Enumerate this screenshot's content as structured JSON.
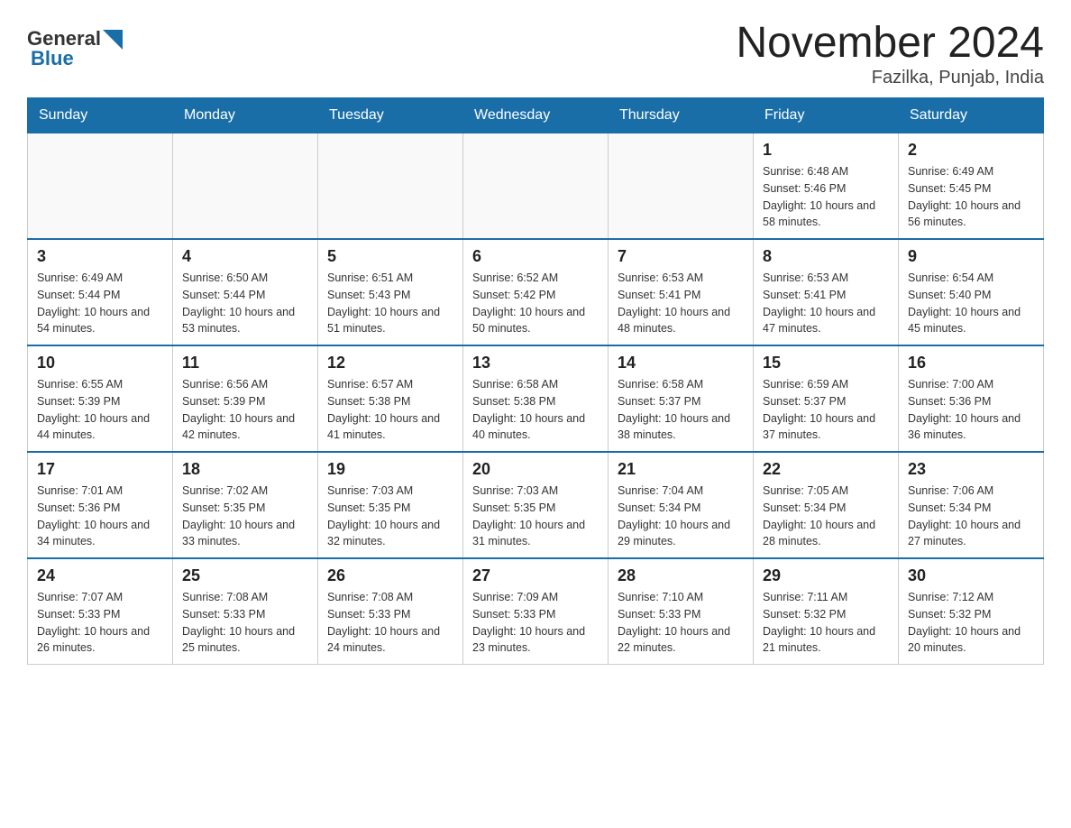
{
  "header": {
    "title": "November 2024",
    "location": "Fazilka, Punjab, India",
    "logo_general": "General",
    "logo_blue": "Blue"
  },
  "weekdays": [
    "Sunday",
    "Monday",
    "Tuesday",
    "Wednesday",
    "Thursday",
    "Friday",
    "Saturday"
  ],
  "weeks": [
    [
      {
        "day": "",
        "info": ""
      },
      {
        "day": "",
        "info": ""
      },
      {
        "day": "",
        "info": ""
      },
      {
        "day": "",
        "info": ""
      },
      {
        "day": "",
        "info": ""
      },
      {
        "day": "1",
        "info": "Sunrise: 6:48 AM\nSunset: 5:46 PM\nDaylight: 10 hours and 58 minutes."
      },
      {
        "day": "2",
        "info": "Sunrise: 6:49 AM\nSunset: 5:45 PM\nDaylight: 10 hours and 56 minutes."
      }
    ],
    [
      {
        "day": "3",
        "info": "Sunrise: 6:49 AM\nSunset: 5:44 PM\nDaylight: 10 hours and 54 minutes."
      },
      {
        "day": "4",
        "info": "Sunrise: 6:50 AM\nSunset: 5:44 PM\nDaylight: 10 hours and 53 minutes."
      },
      {
        "day": "5",
        "info": "Sunrise: 6:51 AM\nSunset: 5:43 PM\nDaylight: 10 hours and 51 minutes."
      },
      {
        "day": "6",
        "info": "Sunrise: 6:52 AM\nSunset: 5:42 PM\nDaylight: 10 hours and 50 minutes."
      },
      {
        "day": "7",
        "info": "Sunrise: 6:53 AM\nSunset: 5:41 PM\nDaylight: 10 hours and 48 minutes."
      },
      {
        "day": "8",
        "info": "Sunrise: 6:53 AM\nSunset: 5:41 PM\nDaylight: 10 hours and 47 minutes."
      },
      {
        "day": "9",
        "info": "Sunrise: 6:54 AM\nSunset: 5:40 PM\nDaylight: 10 hours and 45 minutes."
      }
    ],
    [
      {
        "day": "10",
        "info": "Sunrise: 6:55 AM\nSunset: 5:39 PM\nDaylight: 10 hours and 44 minutes."
      },
      {
        "day": "11",
        "info": "Sunrise: 6:56 AM\nSunset: 5:39 PM\nDaylight: 10 hours and 42 minutes."
      },
      {
        "day": "12",
        "info": "Sunrise: 6:57 AM\nSunset: 5:38 PM\nDaylight: 10 hours and 41 minutes."
      },
      {
        "day": "13",
        "info": "Sunrise: 6:58 AM\nSunset: 5:38 PM\nDaylight: 10 hours and 40 minutes."
      },
      {
        "day": "14",
        "info": "Sunrise: 6:58 AM\nSunset: 5:37 PM\nDaylight: 10 hours and 38 minutes."
      },
      {
        "day": "15",
        "info": "Sunrise: 6:59 AM\nSunset: 5:37 PM\nDaylight: 10 hours and 37 minutes."
      },
      {
        "day": "16",
        "info": "Sunrise: 7:00 AM\nSunset: 5:36 PM\nDaylight: 10 hours and 36 minutes."
      }
    ],
    [
      {
        "day": "17",
        "info": "Sunrise: 7:01 AM\nSunset: 5:36 PM\nDaylight: 10 hours and 34 minutes."
      },
      {
        "day": "18",
        "info": "Sunrise: 7:02 AM\nSunset: 5:35 PM\nDaylight: 10 hours and 33 minutes."
      },
      {
        "day": "19",
        "info": "Sunrise: 7:03 AM\nSunset: 5:35 PM\nDaylight: 10 hours and 32 minutes."
      },
      {
        "day": "20",
        "info": "Sunrise: 7:03 AM\nSunset: 5:35 PM\nDaylight: 10 hours and 31 minutes."
      },
      {
        "day": "21",
        "info": "Sunrise: 7:04 AM\nSunset: 5:34 PM\nDaylight: 10 hours and 29 minutes."
      },
      {
        "day": "22",
        "info": "Sunrise: 7:05 AM\nSunset: 5:34 PM\nDaylight: 10 hours and 28 minutes."
      },
      {
        "day": "23",
        "info": "Sunrise: 7:06 AM\nSunset: 5:34 PM\nDaylight: 10 hours and 27 minutes."
      }
    ],
    [
      {
        "day": "24",
        "info": "Sunrise: 7:07 AM\nSunset: 5:33 PM\nDaylight: 10 hours and 26 minutes."
      },
      {
        "day": "25",
        "info": "Sunrise: 7:08 AM\nSunset: 5:33 PM\nDaylight: 10 hours and 25 minutes."
      },
      {
        "day": "26",
        "info": "Sunrise: 7:08 AM\nSunset: 5:33 PM\nDaylight: 10 hours and 24 minutes."
      },
      {
        "day": "27",
        "info": "Sunrise: 7:09 AM\nSunset: 5:33 PM\nDaylight: 10 hours and 23 minutes."
      },
      {
        "day": "28",
        "info": "Sunrise: 7:10 AM\nSunset: 5:33 PM\nDaylight: 10 hours and 22 minutes."
      },
      {
        "day": "29",
        "info": "Sunrise: 7:11 AM\nSunset: 5:32 PM\nDaylight: 10 hours and 21 minutes."
      },
      {
        "day": "30",
        "info": "Sunrise: 7:12 AM\nSunset: 5:32 PM\nDaylight: 10 hours and 20 minutes."
      }
    ]
  ],
  "colors": {
    "header_bg": "#1a6ea8",
    "accent_blue": "#1a6ea8"
  }
}
